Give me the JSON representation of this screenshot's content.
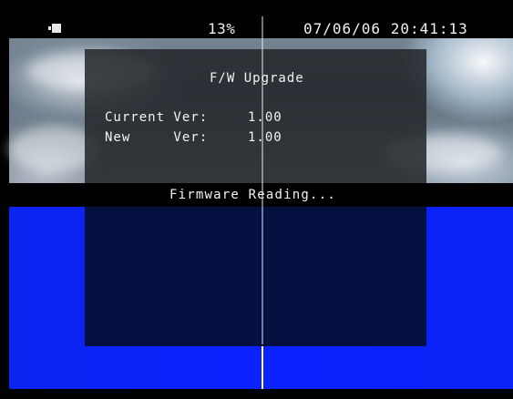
{
  "osd": {
    "battery_percent": "13%",
    "datetime": "07/06/06 20:41:13",
    "camera_icon": "camera-mode-icon"
  },
  "dialog": {
    "title": "F/W Upgrade",
    "current_label": "Current Ver:",
    "current_value": "1.00",
    "new_label": "New     Ver:",
    "new_value": "1.00"
  },
  "status": {
    "message": "Firmware Reading..."
  },
  "colors": {
    "accent_blue": "#0a22ff",
    "panel_navy": "#04103f"
  }
}
